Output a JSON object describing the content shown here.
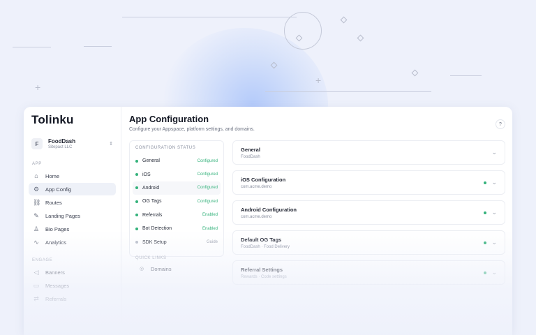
{
  "logo": "Tolinku",
  "org": {
    "initial": "F",
    "name": "FoodDash",
    "company": "Sitepact LLC"
  },
  "sidebar": {
    "app_label": "APP",
    "items": [
      {
        "label": "Home",
        "icon": "home-icon"
      },
      {
        "label": "App Config",
        "icon": "gear-icon",
        "active": true
      },
      {
        "label": "Routes",
        "icon": "link-icon"
      },
      {
        "label": "Landing Pages",
        "icon": "brush-icon"
      },
      {
        "label": "Bio Pages",
        "icon": "person-icon"
      },
      {
        "label": "Analytics",
        "icon": "chart-icon"
      }
    ],
    "engage_label": "ENGAGE",
    "engage_items": [
      {
        "label": "Banners",
        "icon": "megaphone-icon"
      },
      {
        "label": "Messages",
        "icon": "message-icon"
      },
      {
        "label": "Referrals",
        "icon": "share-icon"
      }
    ]
  },
  "header": {
    "title": "App Configuration",
    "subtitle": "Configure your Appspace, platform settings, and domains.",
    "help": "?"
  },
  "status": {
    "title": "CONFIGURATION STATUS",
    "rows": [
      {
        "name": "General",
        "value": "Configured",
        "state": "ok"
      },
      {
        "name": "iOS",
        "value": "Configured",
        "state": "ok"
      },
      {
        "name": "Android",
        "value": "Configured",
        "state": "ok"
      },
      {
        "name": "OG Tags",
        "value": "Configured",
        "state": "ok"
      },
      {
        "name": "Referrals",
        "value": "Enabled",
        "state": "ok"
      },
      {
        "name": "Bot Detection",
        "value": "Enabled",
        "state": "ok"
      },
      {
        "name": "SDK Setup",
        "value": "Guide",
        "state": "muted"
      }
    ],
    "section2_title": "QUICK LINKS",
    "section2_item": "Domains"
  },
  "accordions": [
    {
      "title": "General",
      "sub": "FoodDash",
      "dot": false
    },
    {
      "title": "iOS Configuration",
      "sub": "com.acme.demo",
      "dot": true
    },
    {
      "title": "Android Configuration",
      "sub": "com.acme.demo",
      "dot": true
    },
    {
      "title": "Default OG Tags",
      "sub": "FoodDash · Food Delivery",
      "dot": true
    },
    {
      "title": "Referral Settings",
      "sub": "Rewards · Code settings",
      "dot": true
    }
  ],
  "colors": {
    "accent_green": "#34b27b",
    "background": "#eef1fb"
  }
}
